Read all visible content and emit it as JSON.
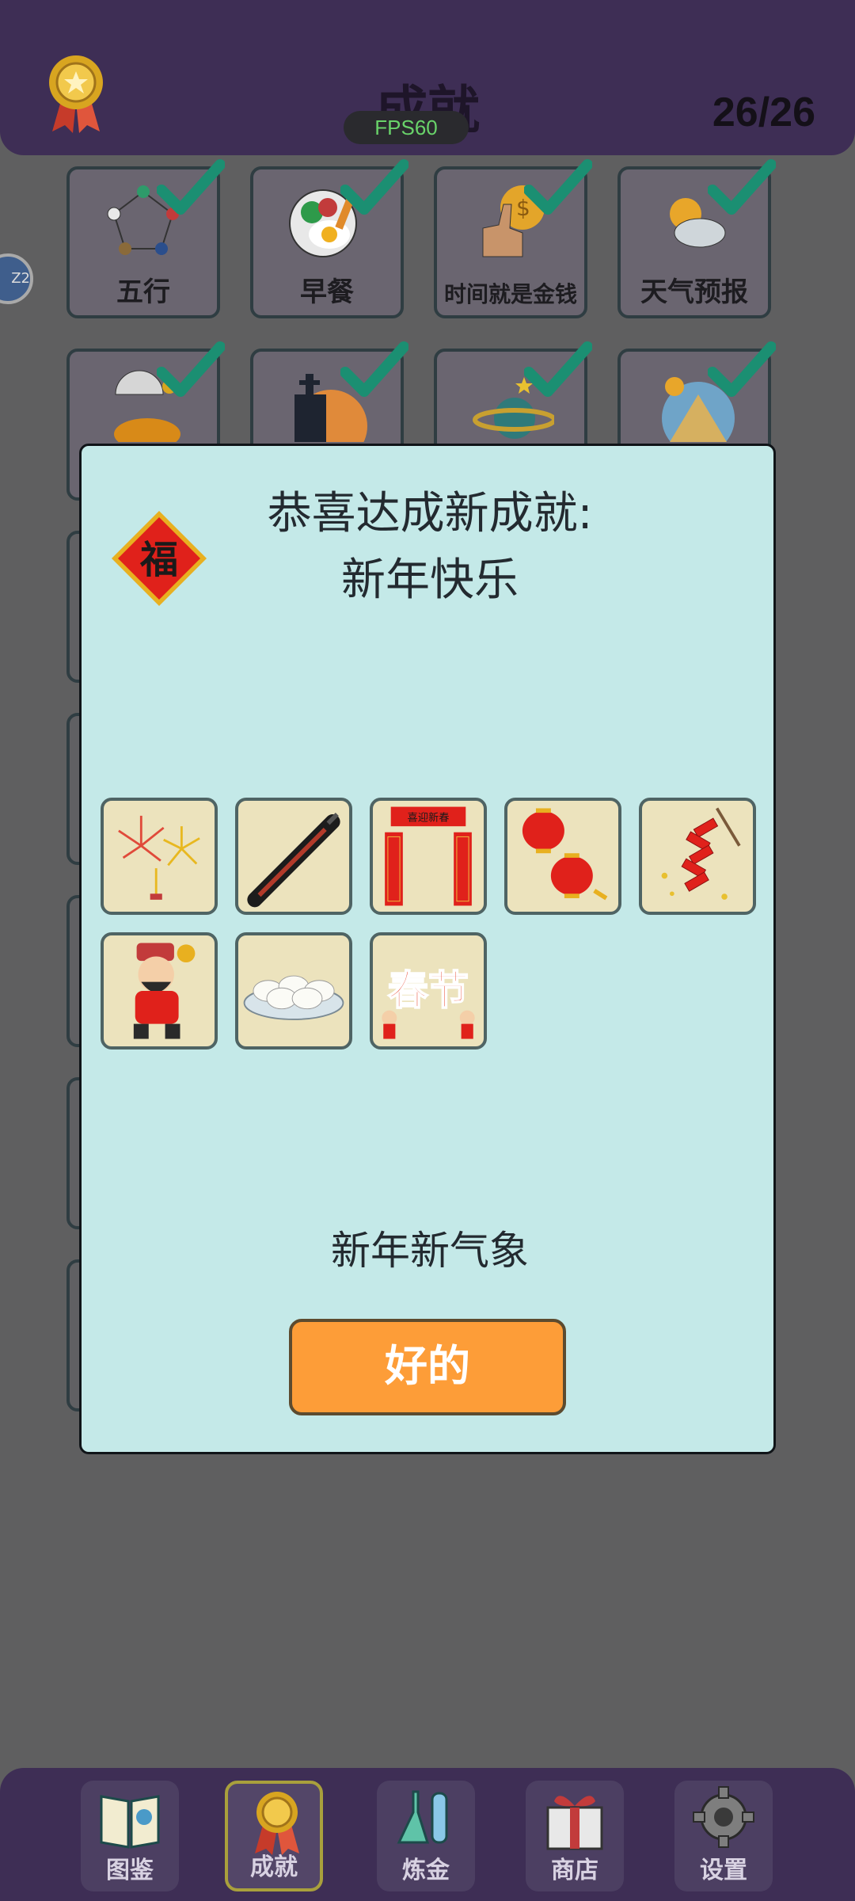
{
  "header": {
    "title": "成就",
    "count": "26/26",
    "fps": "FPS60",
    "side_badge": "Z2"
  },
  "achievements": [
    {
      "label": "五行",
      "icon": "five-elements-icon",
      "done": true
    },
    {
      "label": "早餐",
      "icon": "breakfast-icon",
      "done": true
    },
    {
      "label": "时间就是金钱",
      "icon": "time-money-icon",
      "done": true
    },
    {
      "label": "天气预报",
      "icon": "weather-icon",
      "done": true
    },
    {
      "label": "",
      "icon": "fruit-umbrella-icon",
      "done": true
    },
    {
      "label": "",
      "icon": "haunted-castle-icon",
      "done": true
    },
    {
      "label": "",
      "icon": "planet-icon",
      "done": true
    },
    {
      "label": "",
      "icon": "pyramid-icon",
      "done": true
    }
  ],
  "modal": {
    "title_line1": "恭喜达成新成就:",
    "title_line2": "新年快乐",
    "fu_char": "福",
    "items": [
      {
        "name": "fireworks-icon"
      },
      {
        "name": "firecracker-stick-icon"
      },
      {
        "name": "couplets-icon"
      },
      {
        "name": "lanterns-icon"
      },
      {
        "name": "firecrackers-icon"
      },
      {
        "name": "god-of-wealth-icon"
      },
      {
        "name": "dumplings-icon"
      },
      {
        "name": "spring-festival-icon"
      }
    ],
    "couplet_top": "喜迎新春",
    "spring_text": "春节",
    "description": "新年新气象",
    "ok_button": "好的"
  },
  "nav": [
    {
      "label": "图鉴",
      "icon": "book-icon",
      "active": false
    },
    {
      "label": "成就",
      "icon": "medal-icon",
      "active": true
    },
    {
      "label": "炼金",
      "icon": "flask-icon",
      "active": false
    },
    {
      "label": "商店",
      "icon": "gift-icon",
      "active": false
    },
    {
      "label": "设置",
      "icon": "gear-icon",
      "active": false
    }
  ],
  "colors": {
    "header_bg": "#3e2e55",
    "modal_bg": "#c4e9e8",
    "ok_button": "#fd9d38",
    "check": "#1b8f72",
    "item_bg": "#ece3bd"
  }
}
